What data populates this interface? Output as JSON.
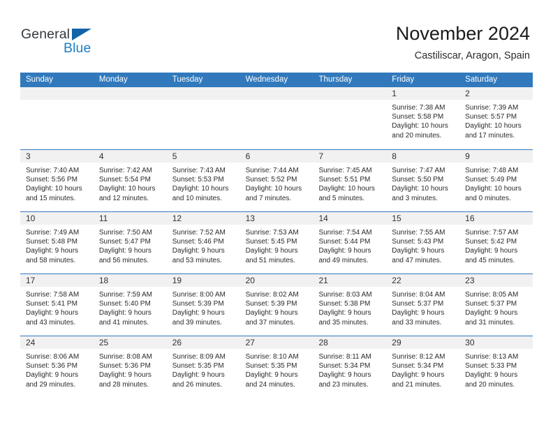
{
  "logo": {
    "primary_text": "General",
    "secondary_text": "Blue",
    "triangle_color": "#1263a8",
    "blue_color": "#1d7ec6"
  },
  "header": {
    "title": "November 2024",
    "subtitle": "Castiliscar, Aragon, Spain"
  },
  "theme": {
    "header_row_bg": "#3179bc",
    "day_number_bg": "#f1f1f1",
    "separator_color": "#3179bc"
  },
  "weekdays": [
    "Sunday",
    "Monday",
    "Tuesday",
    "Wednesday",
    "Thursday",
    "Friday",
    "Saturday"
  ],
  "weeks": [
    [
      {
        "day": "",
        "sunrise": "",
        "sunset": "",
        "daylight_line1": "",
        "daylight_line2": ""
      },
      {
        "day": "",
        "sunrise": "",
        "sunset": "",
        "daylight_line1": "",
        "daylight_line2": ""
      },
      {
        "day": "",
        "sunrise": "",
        "sunset": "",
        "daylight_line1": "",
        "daylight_line2": ""
      },
      {
        "day": "",
        "sunrise": "",
        "sunset": "",
        "daylight_line1": "",
        "daylight_line2": ""
      },
      {
        "day": "",
        "sunrise": "",
        "sunset": "",
        "daylight_line1": "",
        "daylight_line2": ""
      },
      {
        "day": "1",
        "sunrise": "Sunrise: 7:38 AM",
        "sunset": "Sunset: 5:58 PM",
        "daylight_line1": "Daylight: 10 hours",
        "daylight_line2": "and 20 minutes."
      },
      {
        "day": "2",
        "sunrise": "Sunrise: 7:39 AM",
        "sunset": "Sunset: 5:57 PM",
        "daylight_line1": "Daylight: 10 hours",
        "daylight_line2": "and 17 minutes."
      }
    ],
    [
      {
        "day": "3",
        "sunrise": "Sunrise: 7:40 AM",
        "sunset": "Sunset: 5:56 PM",
        "daylight_line1": "Daylight: 10 hours",
        "daylight_line2": "and 15 minutes."
      },
      {
        "day": "4",
        "sunrise": "Sunrise: 7:42 AM",
        "sunset": "Sunset: 5:54 PM",
        "daylight_line1": "Daylight: 10 hours",
        "daylight_line2": "and 12 minutes."
      },
      {
        "day": "5",
        "sunrise": "Sunrise: 7:43 AM",
        "sunset": "Sunset: 5:53 PM",
        "daylight_line1": "Daylight: 10 hours",
        "daylight_line2": "and 10 minutes."
      },
      {
        "day": "6",
        "sunrise": "Sunrise: 7:44 AM",
        "sunset": "Sunset: 5:52 PM",
        "daylight_line1": "Daylight: 10 hours",
        "daylight_line2": "and 7 minutes."
      },
      {
        "day": "7",
        "sunrise": "Sunrise: 7:45 AM",
        "sunset": "Sunset: 5:51 PM",
        "daylight_line1": "Daylight: 10 hours",
        "daylight_line2": "and 5 minutes."
      },
      {
        "day": "8",
        "sunrise": "Sunrise: 7:47 AM",
        "sunset": "Sunset: 5:50 PM",
        "daylight_line1": "Daylight: 10 hours",
        "daylight_line2": "and 3 minutes."
      },
      {
        "day": "9",
        "sunrise": "Sunrise: 7:48 AM",
        "sunset": "Sunset: 5:49 PM",
        "daylight_line1": "Daylight: 10 hours",
        "daylight_line2": "and 0 minutes."
      }
    ],
    [
      {
        "day": "10",
        "sunrise": "Sunrise: 7:49 AM",
        "sunset": "Sunset: 5:48 PM",
        "daylight_line1": "Daylight: 9 hours",
        "daylight_line2": "and 58 minutes."
      },
      {
        "day": "11",
        "sunrise": "Sunrise: 7:50 AM",
        "sunset": "Sunset: 5:47 PM",
        "daylight_line1": "Daylight: 9 hours",
        "daylight_line2": "and 56 minutes."
      },
      {
        "day": "12",
        "sunrise": "Sunrise: 7:52 AM",
        "sunset": "Sunset: 5:46 PM",
        "daylight_line1": "Daylight: 9 hours",
        "daylight_line2": "and 53 minutes."
      },
      {
        "day": "13",
        "sunrise": "Sunrise: 7:53 AM",
        "sunset": "Sunset: 5:45 PM",
        "daylight_line1": "Daylight: 9 hours",
        "daylight_line2": "and 51 minutes."
      },
      {
        "day": "14",
        "sunrise": "Sunrise: 7:54 AM",
        "sunset": "Sunset: 5:44 PM",
        "daylight_line1": "Daylight: 9 hours",
        "daylight_line2": "and 49 minutes."
      },
      {
        "day": "15",
        "sunrise": "Sunrise: 7:55 AM",
        "sunset": "Sunset: 5:43 PM",
        "daylight_line1": "Daylight: 9 hours",
        "daylight_line2": "and 47 minutes."
      },
      {
        "day": "16",
        "sunrise": "Sunrise: 7:57 AM",
        "sunset": "Sunset: 5:42 PM",
        "daylight_line1": "Daylight: 9 hours",
        "daylight_line2": "and 45 minutes."
      }
    ],
    [
      {
        "day": "17",
        "sunrise": "Sunrise: 7:58 AM",
        "sunset": "Sunset: 5:41 PM",
        "daylight_line1": "Daylight: 9 hours",
        "daylight_line2": "and 43 minutes."
      },
      {
        "day": "18",
        "sunrise": "Sunrise: 7:59 AM",
        "sunset": "Sunset: 5:40 PM",
        "daylight_line1": "Daylight: 9 hours",
        "daylight_line2": "and 41 minutes."
      },
      {
        "day": "19",
        "sunrise": "Sunrise: 8:00 AM",
        "sunset": "Sunset: 5:39 PM",
        "daylight_line1": "Daylight: 9 hours",
        "daylight_line2": "and 39 minutes."
      },
      {
        "day": "20",
        "sunrise": "Sunrise: 8:02 AM",
        "sunset": "Sunset: 5:39 PM",
        "daylight_line1": "Daylight: 9 hours",
        "daylight_line2": "and 37 minutes."
      },
      {
        "day": "21",
        "sunrise": "Sunrise: 8:03 AM",
        "sunset": "Sunset: 5:38 PM",
        "daylight_line1": "Daylight: 9 hours",
        "daylight_line2": "and 35 minutes."
      },
      {
        "day": "22",
        "sunrise": "Sunrise: 8:04 AM",
        "sunset": "Sunset: 5:37 PM",
        "daylight_line1": "Daylight: 9 hours",
        "daylight_line2": "and 33 minutes."
      },
      {
        "day": "23",
        "sunrise": "Sunrise: 8:05 AM",
        "sunset": "Sunset: 5:37 PM",
        "daylight_line1": "Daylight: 9 hours",
        "daylight_line2": "and 31 minutes."
      }
    ],
    [
      {
        "day": "24",
        "sunrise": "Sunrise: 8:06 AM",
        "sunset": "Sunset: 5:36 PM",
        "daylight_line1": "Daylight: 9 hours",
        "daylight_line2": "and 29 minutes."
      },
      {
        "day": "25",
        "sunrise": "Sunrise: 8:08 AM",
        "sunset": "Sunset: 5:36 PM",
        "daylight_line1": "Daylight: 9 hours",
        "daylight_line2": "and 28 minutes."
      },
      {
        "day": "26",
        "sunrise": "Sunrise: 8:09 AM",
        "sunset": "Sunset: 5:35 PM",
        "daylight_line1": "Daylight: 9 hours",
        "daylight_line2": "and 26 minutes."
      },
      {
        "day": "27",
        "sunrise": "Sunrise: 8:10 AM",
        "sunset": "Sunset: 5:35 PM",
        "daylight_line1": "Daylight: 9 hours",
        "daylight_line2": "and 24 minutes."
      },
      {
        "day": "28",
        "sunrise": "Sunrise: 8:11 AM",
        "sunset": "Sunset: 5:34 PM",
        "daylight_line1": "Daylight: 9 hours",
        "daylight_line2": "and 23 minutes."
      },
      {
        "day": "29",
        "sunrise": "Sunrise: 8:12 AM",
        "sunset": "Sunset: 5:34 PM",
        "daylight_line1": "Daylight: 9 hours",
        "daylight_line2": "and 21 minutes."
      },
      {
        "day": "30",
        "sunrise": "Sunrise: 8:13 AM",
        "sunset": "Sunset: 5:33 PM",
        "daylight_line1": "Daylight: 9 hours",
        "daylight_line2": "and 20 minutes."
      }
    ]
  ]
}
